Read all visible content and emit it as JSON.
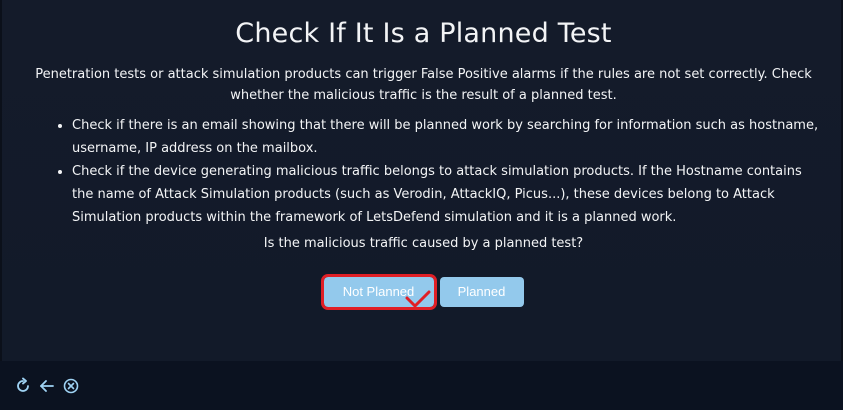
{
  "title": "Check If It Is a Planned Test",
  "intro": "Penetration tests or attack simulation products can trigger False Positive alarms if the rules are not set correctly. Check whether the malicious traffic is the result of a planned test.",
  "bullets": [
    "Check if there is an email showing that there will be planned work by searching for information such as hostname, username, IP address on the mailbox.",
    "Check if the device generating malicious traffic belongs to attack simulation products. If the Hostname contains the name of Attack Simulation products (such as Verodin, AttackIQ, Picus...), these devices belong to Attack Simulation products within the framework of LetsDefend simulation and it is a planned work."
  ],
  "question": "Is the malicious traffic caused by a planned test?",
  "buttons": {
    "not_planned": "Not Planned",
    "planned": "Planned"
  },
  "footer": {
    "icons": [
      "refresh-icon",
      "back-arrow-icon",
      "close-circle-icon"
    ]
  },
  "colors": {
    "background": "#131a28",
    "button": "#93c9ec",
    "selection_outline": "#e01f26",
    "footer": "#0b1220"
  }
}
